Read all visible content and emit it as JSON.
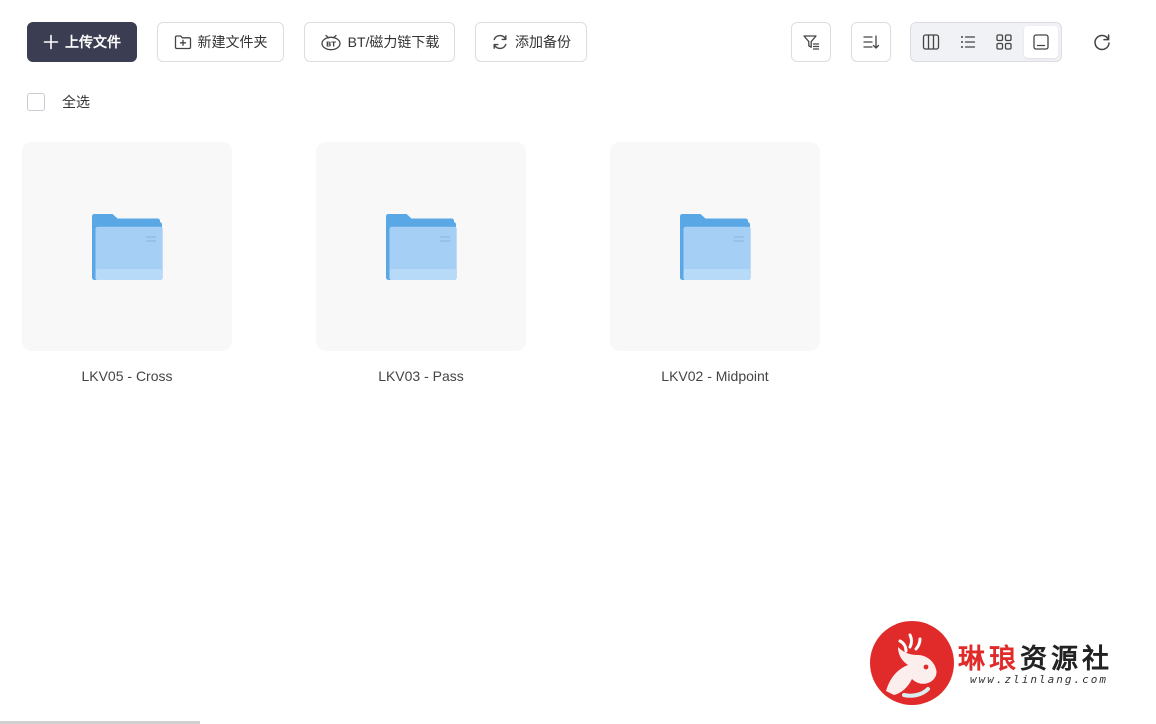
{
  "toolbar": {
    "upload_label": "上传文件",
    "new_folder_label": "新建文件夹",
    "bt_label": "BT/磁力链下载",
    "backup_label": "添加备份"
  },
  "view_modes": [
    "columns-view",
    "list-view",
    "grid-view",
    "preview-view"
  ],
  "active_view": "preview-view",
  "select_all_label": "全选",
  "folders": [
    {
      "name": "LKV05 - Cross"
    },
    {
      "name": "LKV03 - Pass"
    },
    {
      "name": "LKV02 - Midpoint"
    }
  ],
  "watermark": {
    "title_red": "琳琅",
    "title_dark": "资源社",
    "url": "www.zlinlang.com"
  },
  "colors": {
    "primary_button": "#3b3d52",
    "folder_blue": "#6aaee8",
    "tile_bg": "#f8f8f8",
    "watermark_red": "#e12b2b"
  }
}
